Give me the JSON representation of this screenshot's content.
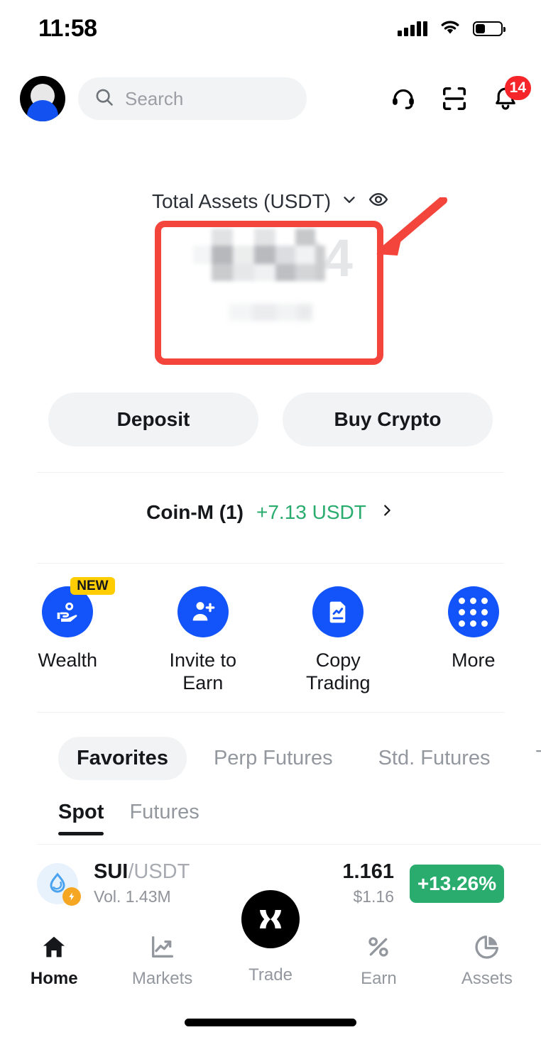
{
  "status_bar": {
    "time": "11:58",
    "signal_icon": "signal-bars-icon",
    "wifi_icon": "wifi-icon",
    "battery_icon": "battery-icon",
    "battery_level_pct": 38
  },
  "header": {
    "avatar_icon": "user-avatar-icon",
    "search": {
      "placeholder": "Search",
      "value": "",
      "icon": "search-icon"
    },
    "support_icon": "headset-support-icon",
    "scan_icon": "qr-scan-icon",
    "notifications_icon": "bell-icon",
    "notifications_count": "14"
  },
  "assets": {
    "title": "Total Assets (USDT)",
    "dropdown_icon": "chevron-down-icon",
    "visibility_icon": "eye-icon",
    "balance_visible_fragment": ".34",
    "balance_hidden": true,
    "sub_value_hidden": true
  },
  "annotation": {
    "box_color": "#f4453c",
    "arrow_color": "#f4453c",
    "target": "total-assets-balance"
  },
  "actions": [
    {
      "label": "Deposit",
      "name": "deposit-button"
    },
    {
      "label": "Buy Crypto",
      "name": "buy-crypto-button"
    }
  ],
  "coin_m": {
    "label": "Coin-M (1)",
    "pnl": "+7.13 USDT",
    "pnl_color": "#2aac6e",
    "chevron_icon": "chevron-right-icon"
  },
  "quick_actions": [
    {
      "label": "Wealth",
      "icon": "hand-coin-icon",
      "badge": "NEW",
      "badge_color": "#ffcd00"
    },
    {
      "label": "Invite to Earn",
      "icon": "user-plus-icon",
      "badge": ""
    },
    {
      "label": "Copy Trading",
      "icon": "document-chart-icon",
      "badge": ""
    },
    {
      "label": "More",
      "icon": "grid-dots-icon",
      "badge": ""
    }
  ],
  "market_tabs": [
    {
      "label": "Favorites",
      "active": true
    },
    {
      "label": "Perp Futures",
      "active": false
    },
    {
      "label": "Std. Futures",
      "active": false
    },
    {
      "label": "Top G",
      "active": false
    }
  ],
  "sub_tabs": [
    {
      "label": "Spot",
      "active": true
    },
    {
      "label": "Futures",
      "active": false
    }
  ],
  "coin_list": [
    {
      "icon": "sui-droplet-icon",
      "badge_icon": "lightning-bolt-icon",
      "base": "SUI",
      "quote": "/USDT",
      "volume": "Vol. 1.43M",
      "price": "1.161",
      "price_usd": "$1.16",
      "change": "+13.26%",
      "change_color": "#2aac6e"
    }
  ],
  "bottom_nav": [
    {
      "label": "Home",
      "icon": "home-icon",
      "active": true
    },
    {
      "label": "Markets",
      "icon": "chart-line-icon",
      "active": false
    },
    {
      "label": "Trade",
      "icon": "trade-x-logo-icon",
      "active": false,
      "center": true
    },
    {
      "label": "Earn",
      "icon": "percent-icon",
      "active": false
    },
    {
      "label": "Assets",
      "icon": "pie-chart-icon",
      "active": false
    }
  ],
  "colors": {
    "brand_blue": "#1253fa",
    "green": "#2aac6e",
    "red": "#f4453c",
    "yellow": "#ffcd00",
    "text": "#15171a",
    "muted": "#93979e",
    "surface": "#f2f3f4"
  }
}
